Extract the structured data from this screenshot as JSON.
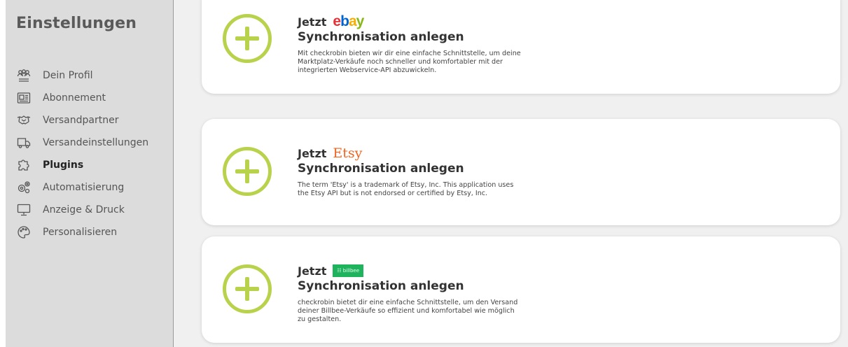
{
  "sidebar": {
    "title": "Einstellungen",
    "items": [
      {
        "label": "Dein Profil",
        "icon": "users-icon",
        "active": false
      },
      {
        "label": "Abonnement",
        "icon": "newspaper-icon",
        "active": false
      },
      {
        "label": "Versandpartner",
        "icon": "handshake-icon",
        "active": false
      },
      {
        "label": "Versandeinstellungen",
        "icon": "truck-icon",
        "active": false
      },
      {
        "label": "Plugins",
        "icon": "puzzle-icon",
        "active": true
      },
      {
        "label": "Automatisierung",
        "icon": "gears-icon",
        "active": false
      },
      {
        "label": "Anzeige & Druck",
        "icon": "monitor-icon",
        "active": false
      },
      {
        "label": "Personalisieren",
        "icon": "palette-icon",
        "active": false
      }
    ]
  },
  "cards": [
    {
      "prefix": "Jetzt",
      "logo": {
        "e": "e",
        "b": "b",
        "a": "a",
        "y": "y"
      },
      "title": "Synchronisation anlegen",
      "description": "Mit checkrobin bieten wir dir eine einfache Schnittstelle, um deine Marktplatz-Verkäufe noch schneller und komfortabler mit der integrierten Webservice-API abzuwickeln."
    },
    {
      "prefix": "Jetzt",
      "logo": "Etsy",
      "title": "Synchronisation anlegen",
      "description": "The term 'Etsy' is a trademark of Etsy, Inc. This application uses the Etsy API but is not endorsed or certified by Etsy, Inc."
    },
    {
      "prefix": "Jetzt",
      "logo": "billbee",
      "title": "Synchronisation anlegen",
      "description": "checkrobin bietet dir eine einfache Schnittstelle, um den Versand deiner Billbee-Verkäufe so effizient und komfortabel wie möglich zu gestalten."
    }
  ],
  "colors": {
    "accent_green": "#b8d24b",
    "sidebar_bg": "#dcdcdc",
    "page_bg": "#f0f0f0",
    "etsy_orange": "#f1641e",
    "billbee_green": "#1fb35e"
  }
}
